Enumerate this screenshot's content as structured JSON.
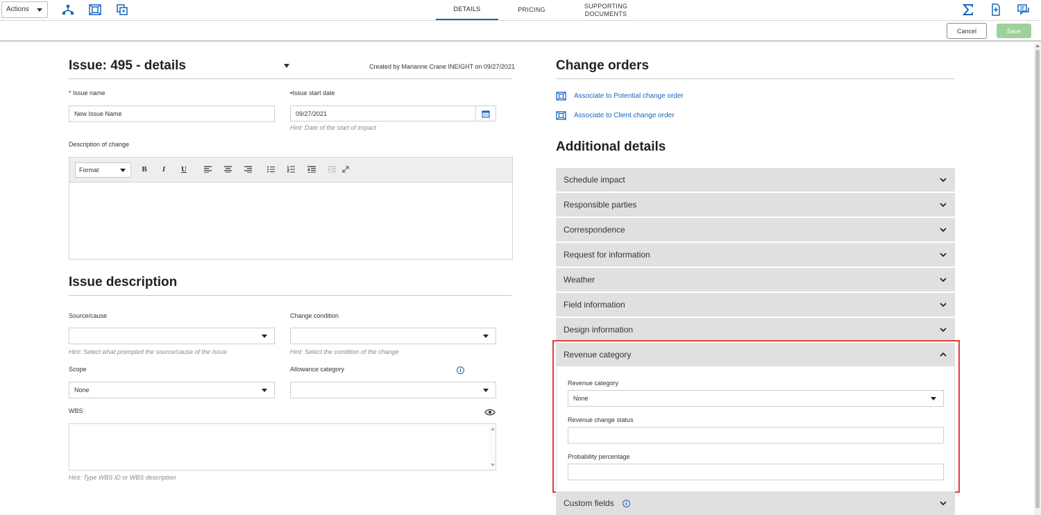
{
  "toolbar": {
    "actions_label": "Actions",
    "icons": [
      "hierarchy-icon",
      "layers-select-icon",
      "copy-icon"
    ],
    "right_icons": [
      "sigma-icon",
      "add-document-icon",
      "comments-icon"
    ]
  },
  "tabs": [
    {
      "label": "DETAILS",
      "active": true
    },
    {
      "label": "PRICING",
      "active": false
    },
    {
      "label": "SUPPORTING DOCUMENTS",
      "active": false
    }
  ],
  "commands": {
    "cancel": "Cancel",
    "save": "Save"
  },
  "issue": {
    "title": "Issue: 495 - details",
    "created_by": "Created by Marianne Crane INEIGHT on 09/27/2021",
    "name_label": "* Issue name",
    "name_value": "New Issue Name",
    "start_label": "•Issue start date",
    "start_value": "09/27/2021",
    "start_hint": "Hint: Date of the start of impact",
    "description_label": "Description of change",
    "format_label": "Format"
  },
  "issue_description": {
    "title": "Issue description",
    "source_label": "Source/cause",
    "source_value": "",
    "source_hint": "Hint: Select what prompted the source/cause of the Issue",
    "condition_label": "Change condition",
    "condition_value": "",
    "condition_hint": "Hint: Select the condition of the change",
    "scope_label": "Scope",
    "scope_value": "None",
    "allowance_label": "Allowance category",
    "allowance_value": "",
    "wbs_label": "WBS",
    "wbs_hint": "Hint: Type WBS ID or WBS description"
  },
  "change_orders": {
    "title": "Change orders",
    "links": [
      "Associate to Potential change order",
      "Associate to Client change order"
    ]
  },
  "additional": {
    "title": "Additional details",
    "sections": [
      "Schedule impact",
      "Responsible parties",
      "Correspondence",
      "Request for information",
      "Weather",
      "Field information",
      "Design information",
      "Revenue category",
      "Custom fields"
    ],
    "revenue": {
      "category_label": "Revenue category",
      "category_value": "None",
      "status_label": "Revenue change status",
      "status_value": "",
      "probability_label": "Probability percentage",
      "probability_value": ""
    }
  },
  "colors": {
    "accent": "#1565c0",
    "save": "#9ed19b",
    "highlight": "#e53935",
    "accordion": "#e0e0e0"
  }
}
